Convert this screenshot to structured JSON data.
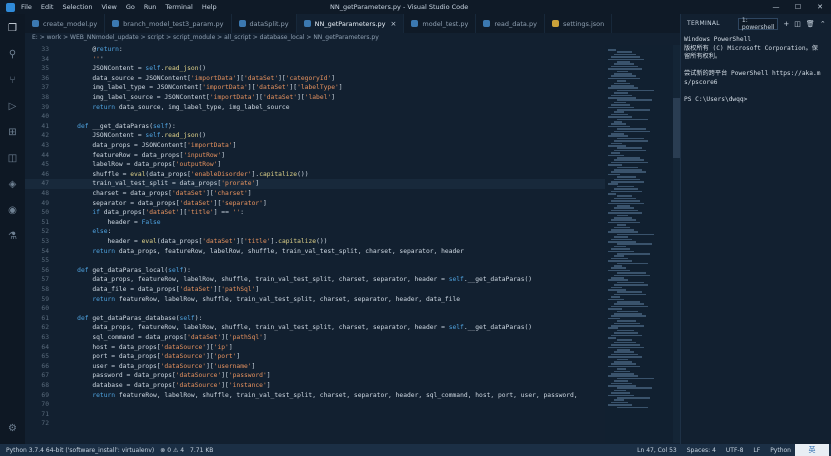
{
  "window": {
    "title": "NN_getParameters.py - Visual Studio Code",
    "menu": [
      "File",
      "Edit",
      "Selection",
      "View",
      "Go",
      "Run",
      "Terminal",
      "Help"
    ]
  },
  "tabs": [
    {
      "label": "create_model.py",
      "active": false
    },
    {
      "label": "branch_model_test3_param.py",
      "active": false
    },
    {
      "label": "dataSplit.py",
      "active": false
    },
    {
      "label": "NN_getParameters.py",
      "active": true
    },
    {
      "label": "model_test.py",
      "active": false
    },
    {
      "label": "read_data.py",
      "active": false
    },
    {
      "label": "settings.json",
      "active": false
    }
  ],
  "breadcrumb": "E: > work > WEB_NNmodel_update > script > script_module > all_script > database_local > NN_getParameters.py",
  "code_lines": [
    {
      "n": "33",
      "t": "        @return:"
    },
    {
      "n": "34",
      "t": "        '''"
    },
    {
      "n": "35",
      "t": "        JSONContent = self.read_json()"
    },
    {
      "n": "36",
      "t": "        data_source = JSONContent['importData']['dataSet']['categoryId']"
    },
    {
      "n": "37",
      "t": "        img_label_type = JSONContent['importData']['dataSet']['labelType']"
    },
    {
      "n": "38",
      "t": "        img_label_source = JSONContent['importData']['dataSet']['label']"
    },
    {
      "n": "39",
      "t": "        return data_source, img_label_type, img_label_source"
    },
    {
      "n": "40",
      "t": ""
    },
    {
      "n": "41",
      "t": "    def __get_dataParas(self):"
    },
    {
      "n": "42",
      "t": "        JSONContent = self.read_json()"
    },
    {
      "n": "43",
      "t": "        data_props = JSONContent['importData']"
    },
    {
      "n": "44",
      "t": "        featureRow = data_props['inputRow']"
    },
    {
      "n": "45",
      "t": "        labelRow = data_props['outputRow']"
    },
    {
      "n": "46",
      "t": "        shuffle = eval(data_props['enableDisorder'].capitalize())"
    },
    {
      "n": "47",
      "t": "        train_val_test_split = data_props['prorate']"
    },
    {
      "n": "48",
      "t": "        charset = data_props['dataSet']['charset']"
    },
    {
      "n": "49",
      "t": "        separator = data_props['dataSet']['separator']"
    },
    {
      "n": "50",
      "t": "        if data_props['dataSet']['title'] == '':"
    },
    {
      "n": "51",
      "t": "            header = False"
    },
    {
      "n": "52",
      "t": "        else:"
    },
    {
      "n": "53",
      "t": "            header = eval(data_props['dataSet']['title'].capitalize())"
    },
    {
      "n": "54",
      "t": "        return data_props, featureRow, labelRow, shuffle, train_val_test_split, charset, separator, header"
    },
    {
      "n": "55",
      "t": ""
    },
    {
      "n": "56",
      "t": "    def get_dataParas_local(self):"
    },
    {
      "n": "57",
      "t": "        data_props, featureRow, labelRow, shuffle, train_val_test_split, charset, separator, header = self.__get_dataParas()"
    },
    {
      "n": "58",
      "t": "        data_file = data_props['dataSet']['pathSql']"
    },
    {
      "n": "59",
      "t": "        return featureRow, labelRow, shuffle, train_val_test_split, charset, separator, header, data_file"
    },
    {
      "n": "60",
      "t": ""
    },
    {
      "n": "61",
      "t": "    def get_dataParas_database(self):"
    },
    {
      "n": "62",
      "t": "        data_props, featureRow, labelRow, shuffle, train_val_test_split, charset, separator, header = self.__get_dataParas()"
    },
    {
      "n": "63",
      "t": "        sql_command = data_props['dataSet']['pathSql']"
    },
    {
      "n": "64",
      "t": "        host = data_props['dataSource']['ip']"
    },
    {
      "n": "65",
      "t": "        port = data_props['dataSource']['port']"
    },
    {
      "n": "66",
      "t": "        user = data_props['dataSource']['username']"
    },
    {
      "n": "67",
      "t": "        password = data_props['dataSource']['password']"
    },
    {
      "n": "68",
      "t": "        database = data_props['dataSource']['instance']"
    },
    {
      "n": "69",
      "t": "        return featureRow, labelRow, shuffle, train_val_test_split, charset, separator, header, sql_command, host, port, user, password,"
    },
    {
      "n": "70",
      "t": ""
    },
    {
      "n": "71",
      "t": ""
    },
    {
      "n": "72",
      "t": ""
    }
  ],
  "terminal": {
    "label": "TERMINAL",
    "select": "1: powershell",
    "lines": [
      "Windows PowerShell",
      "版权所有 (C) Microsoft Corporation。保",
      "留所有权利。",
      "",
      "尝试新的跨平台 PowerShell https://aka.m",
      "s/pscore6",
      "",
      "PS C:\\Users\\dwqq>"
    ]
  },
  "status": {
    "python": "Python 3.7.4 64-bit ('software_install': virtualenv)",
    "problems": "⊗ 0 ⚠ 4",
    "size": "7.71 KB",
    "position": "Ln 47, Col 53",
    "spaces": "Spaces: 4",
    "encoding": "UTF-8",
    "eol": "LF",
    "language": "Python",
    "ime": "英"
  },
  "colors": {
    "editor_bg": "#122030",
    "keyword": "#4fa3e0",
    "string": "#e8935f",
    "function": "#e0d38a",
    "comment": "#6a9955"
  }
}
